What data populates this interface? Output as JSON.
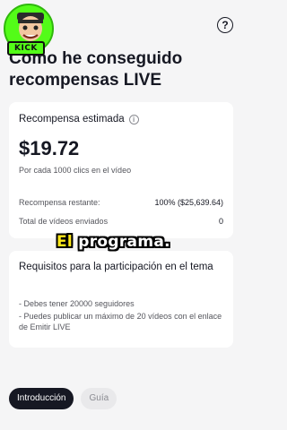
{
  "overlay": {
    "avatar_tag": "KICK",
    "caption_highlight": "El",
    "caption_rest": " programa."
  },
  "header": {
    "help_symbol": "?",
    "title": "Cómo he conseguido recompensas LIVE"
  },
  "reward_card": {
    "label": "Recompensa estimada",
    "amount": "$19.72",
    "per_clicks": "Por cada 1000 clics en el vídeo",
    "stats": [
      {
        "label": "Recompensa restante:",
        "value": "100% ($25,639.64)"
      },
      {
        "label": "Total de vídeos enviados",
        "value": "0"
      }
    ]
  },
  "requirements_card": {
    "title": "Requisitos para la participación en el tema",
    "items": [
      "- Debes tener 20000 seguidores",
      "- Puedes publicar un máximo de 20 vídeos con el enlace de Emitir LIVE"
    ]
  },
  "tabs": [
    {
      "label": "Introducción",
      "active": true
    },
    {
      "label": "Guía",
      "active": false
    }
  ],
  "colors": {
    "accent_green": "#53fc18",
    "caption_yellow": "#ffe81a",
    "text_primary": "#161823"
  }
}
